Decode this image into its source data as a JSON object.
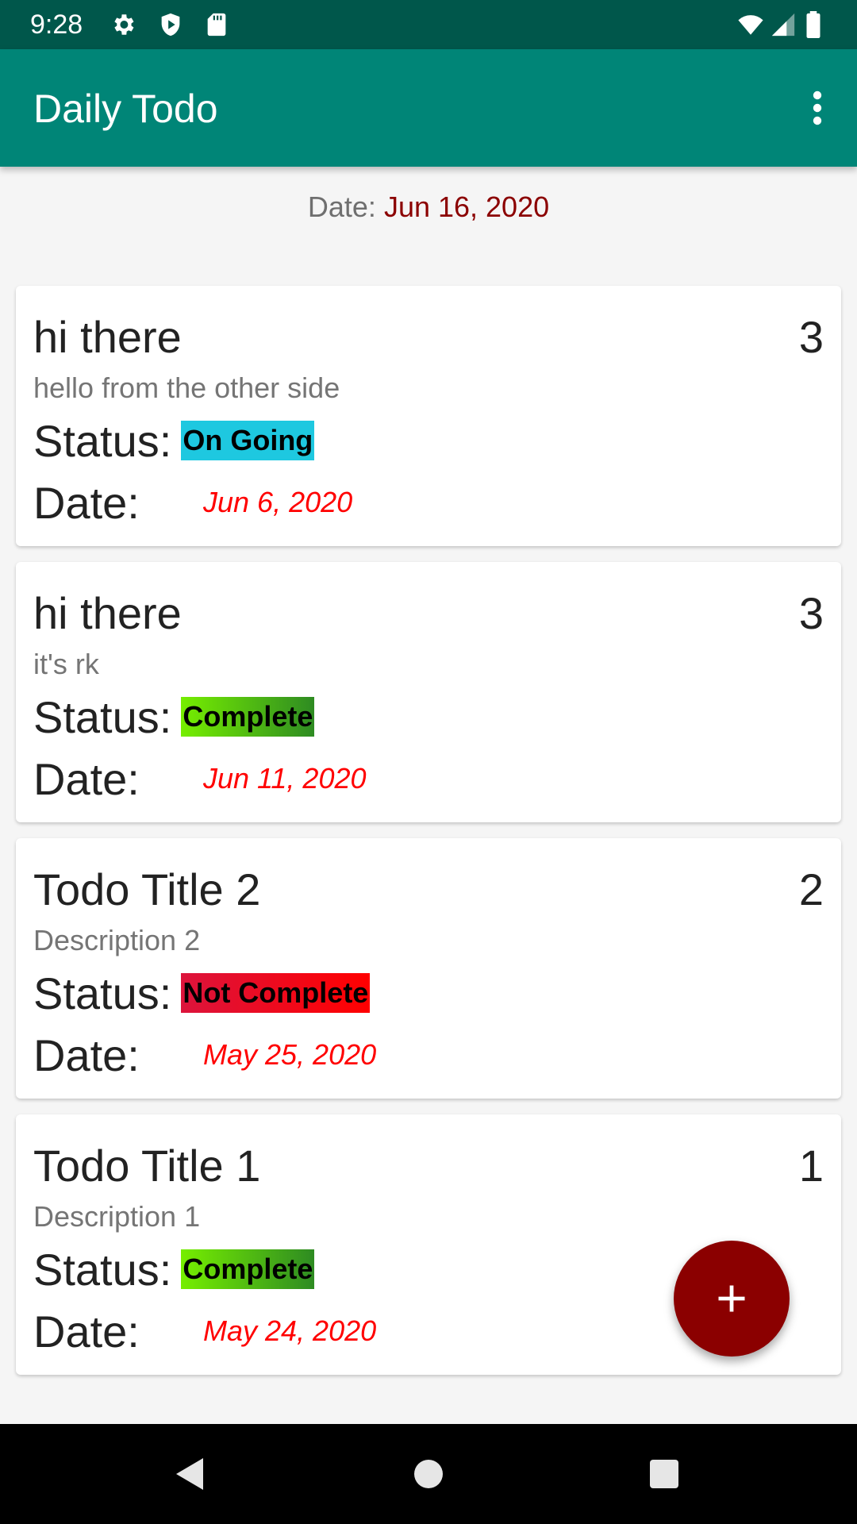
{
  "status_bar": {
    "time": "9:28",
    "left_icons": [
      "settings-icon",
      "shield-icon",
      "sd-card-icon"
    ],
    "right_icons": [
      "wifi-icon",
      "signal-icon",
      "battery-icon"
    ]
  },
  "app_bar": {
    "title": "Daily Todo",
    "overflow_icon": "more-vert-icon"
  },
  "date_header": {
    "label": "Date:",
    "value": "Jun 16, 2020"
  },
  "labels": {
    "status": "Status:",
    "date": "Date:"
  },
  "todos": [
    {
      "title": "hi there",
      "priority": "3",
      "description": "hello from the other side",
      "status": "On Going",
      "status_color": "#1ec8e0",
      "date": "Jun 6, 2020"
    },
    {
      "title": "hi there",
      "priority": "3",
      "description": "it's rk",
      "status": "Complete",
      "status_color": "#4caf1f",
      "date": "Jun 11, 2020"
    },
    {
      "title": "Todo Title 2",
      "priority": "2",
      "description": "Description 2",
      "status": "Not Complete",
      "status_color": "#ff0000",
      "date": "May 25, 2020"
    },
    {
      "title": "Todo Title 1",
      "priority": "1",
      "description": "Description 1",
      "status": "Complete",
      "status_color": "#4caf1f",
      "date": "May 24, 2020"
    }
  ],
  "fab": {
    "icon": "add-icon",
    "color": "#8b0000"
  },
  "nav_bar": {
    "icons": [
      "back-icon",
      "home-icon",
      "recents-icon"
    ]
  },
  "colors": {
    "status_bar": "#00574b",
    "app_bar": "#008577",
    "date_accent": "#8b0000",
    "todo_date": "#ff0000"
  }
}
